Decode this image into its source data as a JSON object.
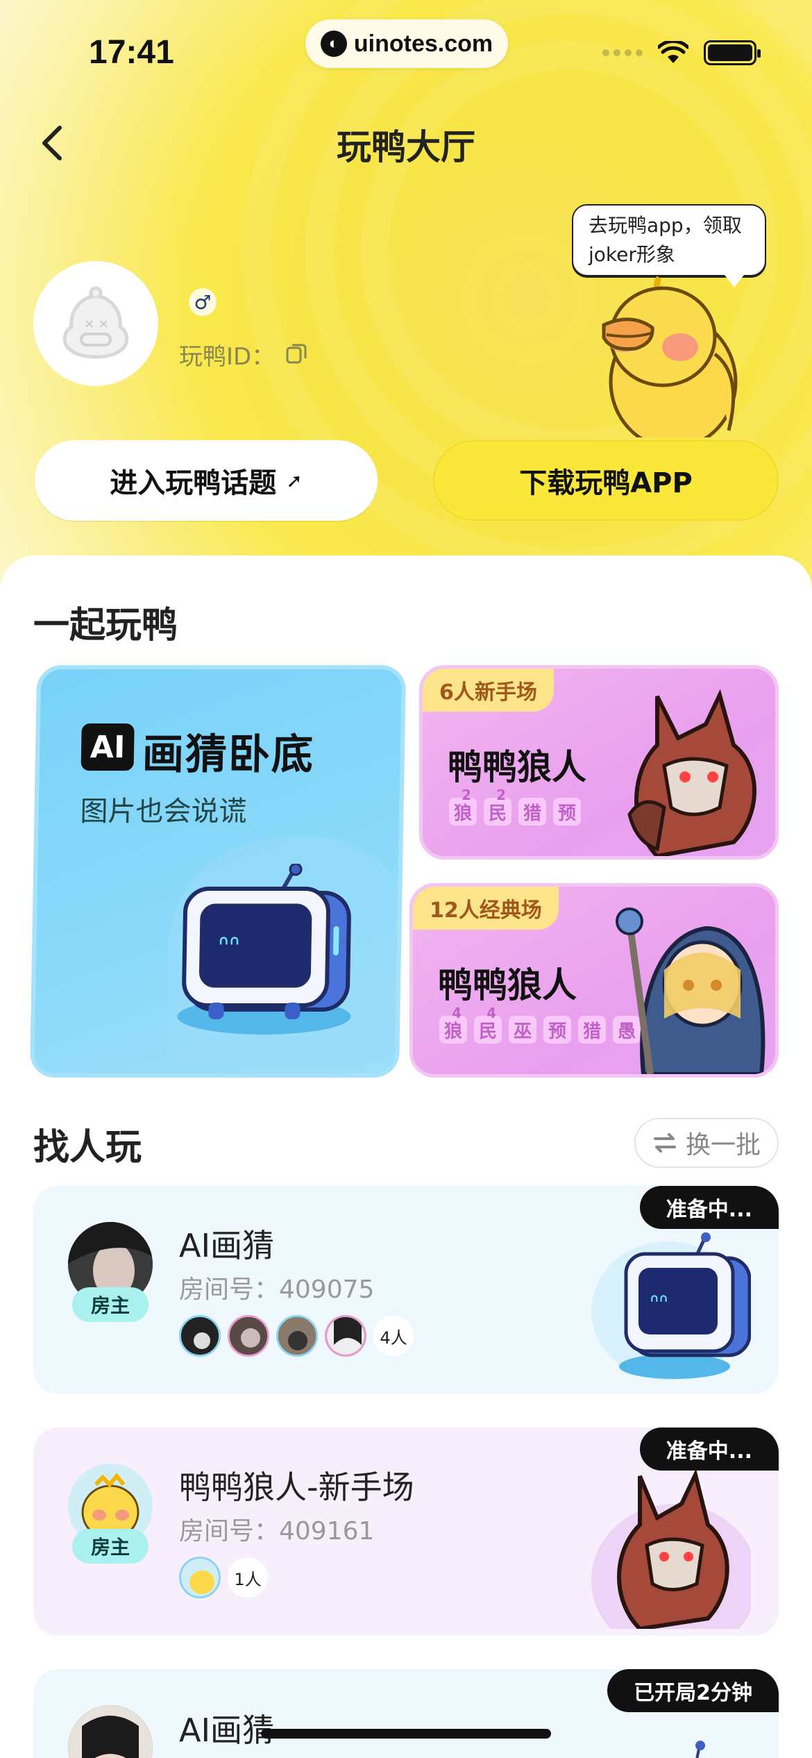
{
  "status_bar": {
    "time": "17:41",
    "url": "uinotes.com"
  },
  "nav": {
    "title": "玩鸭大厅"
  },
  "profile": {
    "gender_symbol": "♂",
    "id_label": "玩鸭ID："
  },
  "mascot": {
    "speech": "去玩鸭app，领取joker形象"
  },
  "actions": {
    "topic_label": "进入玩鸭话题",
    "topic_arrow": "➚",
    "download_label": "下载玩鸭APP"
  },
  "play_together": {
    "title": "一起玩鸭",
    "ai_card": {
      "badge": "AI",
      "title": "画猜卧底",
      "subtitle": "图片也会说谎"
    },
    "wolf_cards": [
      {
        "tag": "6人新手场",
        "title": "鸭鸭狼人",
        "roles": [
          {
            "char": "狼",
            "sup": "2"
          },
          {
            "char": "民",
            "sup": "2"
          },
          {
            "char": "猎",
            "sup": ""
          },
          {
            "char": "预",
            "sup": ""
          }
        ]
      },
      {
        "tag": "12人经典场",
        "title": "鸭鸭狼人",
        "roles": [
          {
            "char": "狼",
            "sup": "4"
          },
          {
            "char": "民",
            "sup": "4"
          },
          {
            "char": "巫",
            "sup": ""
          },
          {
            "char": "预",
            "sup": ""
          },
          {
            "char": "猎",
            "sup": ""
          },
          {
            "char": "愚",
            "sup": ""
          }
        ]
      }
    ]
  },
  "find_players": {
    "title": "找人玩",
    "refresh_label": "换一批",
    "host_label": "房主",
    "rooms": [
      {
        "status": "准备中...",
        "name": "AI画猜",
        "room_no": "房间号：409075",
        "count": "4人",
        "bg": "#eef8fd"
      },
      {
        "status": "准备中...",
        "name": "鸭鸭狼人-新手场",
        "room_no": "房间号：409161",
        "count": "1人",
        "bg": "#f7effc"
      },
      {
        "status": "已开局2分钟",
        "name": "AI画猜",
        "room_no": "",
        "count": "",
        "bg": "#eef8fd"
      }
    ]
  },
  "colors": {
    "accent_yellow": "#f9e73a",
    "ai_blue": "#79d2f8",
    "wolf_pink": "#e9a0ee"
  }
}
